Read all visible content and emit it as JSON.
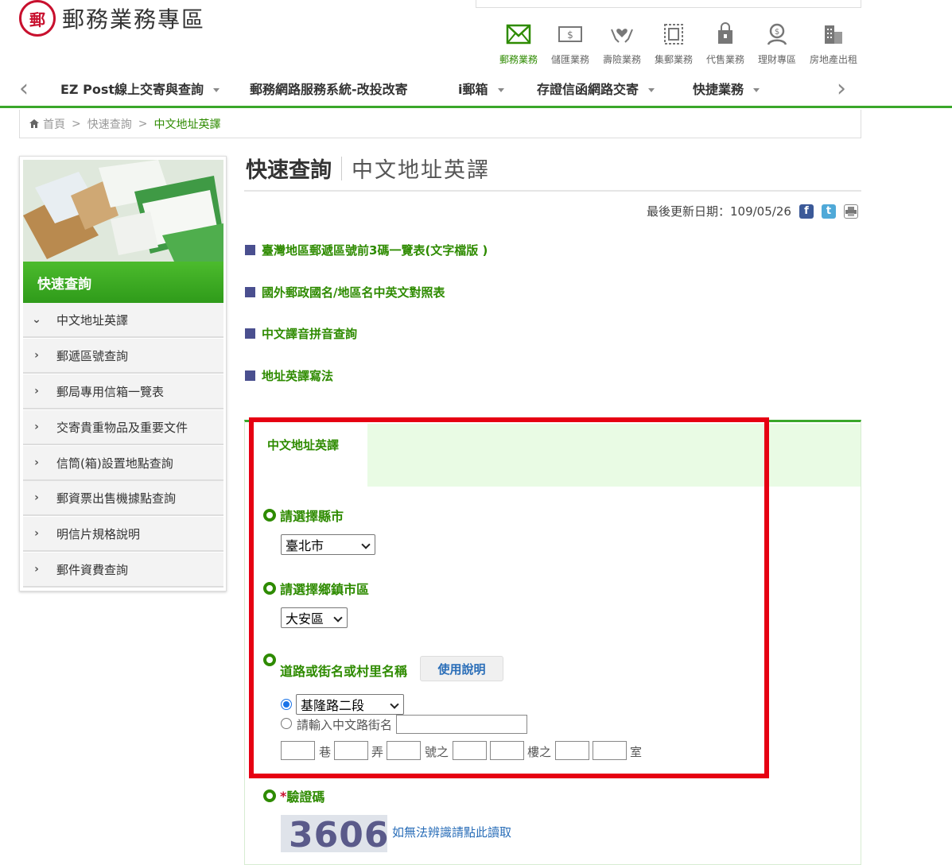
{
  "header": {
    "logo_char": "郵",
    "site_title": "郵務業務專區",
    "services": [
      {
        "label": "郵務業務",
        "icon": "envelope-icon"
      },
      {
        "label": "儲匯業務",
        "icon": "dollar-bill-icon"
      },
      {
        "label": "壽險業務",
        "icon": "hands-heart-icon"
      },
      {
        "label": "集郵業務",
        "icon": "stamp-icon"
      },
      {
        "label": "代售業務",
        "icon": "shopping-bag-icon"
      },
      {
        "label": "理財專區",
        "icon": "money-person-icon"
      },
      {
        "label": "房地產出租",
        "icon": "building-icon"
      }
    ]
  },
  "nav": {
    "items": [
      {
        "label": "EZ Post線上交寄與查詢",
        "has_dropdown": true
      },
      {
        "label": "郵務網路服務系統-改投改寄",
        "has_dropdown": false
      },
      {
        "label": "i郵箱",
        "has_dropdown": true
      },
      {
        "label": "存證信函網路交寄",
        "has_dropdown": true
      },
      {
        "label": "快捷業務",
        "has_dropdown": true
      }
    ],
    "prev": "‹",
    "next": "›"
  },
  "breadcrumb": {
    "home": "首頁",
    "sep": ">",
    "level1": "快速查詢",
    "current": "中文地址英譯"
  },
  "sidebar": {
    "heading": "快速查詢",
    "items": [
      {
        "label": "中文地址英譯",
        "expanded": true
      },
      {
        "label": "郵遞區號查詢",
        "expanded": false
      },
      {
        "label": "郵局專用信箱一覽表",
        "expanded": false
      },
      {
        "label": "交寄貴重物品及重要文件",
        "expanded": false
      },
      {
        "label": "信筒(箱)設置地點查詢",
        "expanded": false
      },
      {
        "label": "郵資票出售機據點查詢",
        "expanded": false
      },
      {
        "label": "明信片規格說明",
        "expanded": false
      },
      {
        "label": "郵件資費查詢",
        "expanded": false
      }
    ]
  },
  "main": {
    "title": "快速查詢",
    "subtitle": "中文地址英譯",
    "updated_label": "最後更新日期：109/05/26",
    "links": [
      "臺灣地區郵遞區號前3碼一覽表(文字檔版 )",
      "國外郵政國名/地區名中英文對照表",
      "中文譯音拼音查詢",
      "地址英譯寫法"
    ],
    "form": {
      "tab_label": "中文地址英譯",
      "county_label": "請選擇縣市",
      "county_value": "臺北市",
      "district_label": "請選擇鄉鎮市區",
      "district_value": "大安區",
      "road_label": "道路或街名或村里名稱",
      "help_button": "使用說明",
      "road_value": "基隆路二段",
      "road_manual_label": "請輸入中文路街名",
      "units": [
        "巷",
        "弄",
        "號之",
        "樓之",
        "室"
      ],
      "captcha_required": "*",
      "captcha_label": "驗證碼",
      "captcha_code": "3606",
      "captcha_refresh": "如無法辨識請點此讀取"
    }
  },
  "colors": {
    "accent_green": "#2e8b00",
    "highlight_red": "#e60012",
    "link_blue": "#2a6eb8"
  }
}
